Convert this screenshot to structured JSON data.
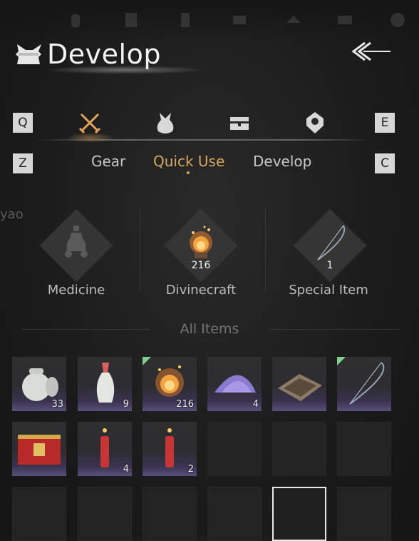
{
  "header": {
    "title": "Develop"
  },
  "categories": [
    {
      "key": "gear",
      "icon": "crossed-swords-icon",
      "active": true
    },
    {
      "key": "pouch",
      "icon": "pouch-icon",
      "active": false
    },
    {
      "key": "chest",
      "icon": "treasure-chest-icon",
      "active": false
    },
    {
      "key": "location",
      "icon": "location-pin-icon",
      "active": false
    }
  ],
  "keys": {
    "prev_category": "Q",
    "next_category": "E",
    "prev_tab": "Z",
    "next_tab": "C"
  },
  "tabs": [
    {
      "label": "Gear",
      "active": false
    },
    {
      "label": "Quick Use",
      "active": true
    },
    {
      "label": "Develop",
      "active": false
    }
  ],
  "side_text": "yao",
  "quick_slots": [
    {
      "label": "Medicine",
      "count": "",
      "icon": "medicine-bottle-icon"
    },
    {
      "label": "Divinecraft",
      "count": "216",
      "icon": "divinecraft-flame-icon"
    },
    {
      "label": "Special Item",
      "count": "1",
      "icon": "bow-icon"
    }
  ],
  "all_items_label": "All Items",
  "items": [
    {
      "icon": "white-jar-icon",
      "count": "33",
      "new": false
    },
    {
      "icon": "porcelain-vase-icon",
      "count": "9",
      "new": false
    },
    {
      "icon": "divinecraft-flame-icon",
      "count": "216",
      "new": true
    },
    {
      "icon": "purple-powder-icon",
      "count": "4",
      "new": false
    },
    {
      "icon": "fence-trap-icon",
      "count": "",
      "new": false
    },
    {
      "icon": "bow-icon",
      "count": "",
      "new": true
    },
    {
      "icon": "red-box-icon",
      "count": "",
      "new": false
    },
    {
      "icon": "firecracker-icon",
      "count": "4",
      "new": false
    },
    {
      "icon": "firecracker-icon",
      "count": "2",
      "new": false
    }
  ],
  "colors": {
    "accent": "#d7a862",
    "text": "#c9c9c9",
    "slot_rarity": "#58507a",
    "new_flag": "#7fcf8f"
  }
}
